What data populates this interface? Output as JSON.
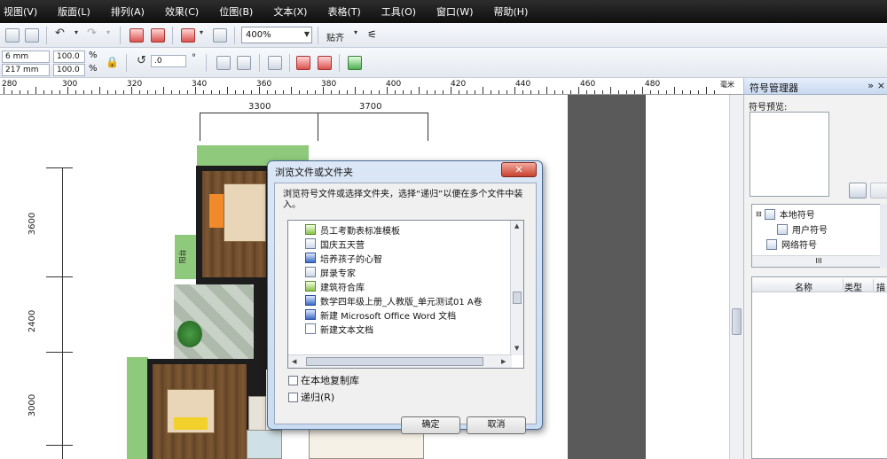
{
  "menu": [
    "视图(V)",
    "版面(L)",
    "排列(A)",
    "效果(C)",
    "位图(B)",
    "文本(X)",
    "表格(T)",
    "工具(O)",
    "窗口(W)",
    "帮助(H)"
  ],
  "toolbar": {
    "zoom_value": "400%",
    "snap_label": "贴齐"
  },
  "property_bar": {
    "width": "6 mm",
    "height": "217 mm",
    "scale_x": "100.0",
    "scale_y": "100.0",
    "percent": "%",
    "angle": ".0",
    "degree": "°"
  },
  "ruler": {
    "unit": "毫米",
    "ticks": [
      "280",
      "300",
      "320",
      "340",
      "360",
      "380",
      "400",
      "420",
      "440",
      "460",
      "480"
    ]
  },
  "drawing": {
    "dim_top_1": "3300",
    "dim_top_2": "3700",
    "dim_left_1": "3600",
    "dim_left_2": "2400",
    "dim_left_3": "3000",
    "label_small": "阳台"
  },
  "dialog": {
    "title": "浏览文件或文件夹",
    "close": "✕",
    "description": "浏览符号文件或选择文件夹，选择“递归”以便在多个文件中装入。",
    "items": [
      "员工考勤表标准模板",
      "国庆五天营",
      "培养孩子的心智",
      "屏录专家",
      "建筑符合库",
      "数学四年级上册_人教版_单元测试01 A卷",
      "新建 Microsoft Office Word 文档",
      "新建文本文档"
    ],
    "check_copy": "在本地复制库",
    "check_recursive": "递归(R)",
    "ok": "确定",
    "cancel": "取消"
  },
  "panel": {
    "title": "符号管理器",
    "collapse": "»",
    "close": "×",
    "preview_label": "符号预览:",
    "tree": [
      "本地符号",
      "用户符号",
      "网络符号"
    ],
    "scroll_label": "III",
    "columns": [
      "名称",
      "类型",
      "描"
    ]
  },
  "colors": {
    "accent_red": "#e0241b",
    "room_green": "#8fc97c"
  }
}
